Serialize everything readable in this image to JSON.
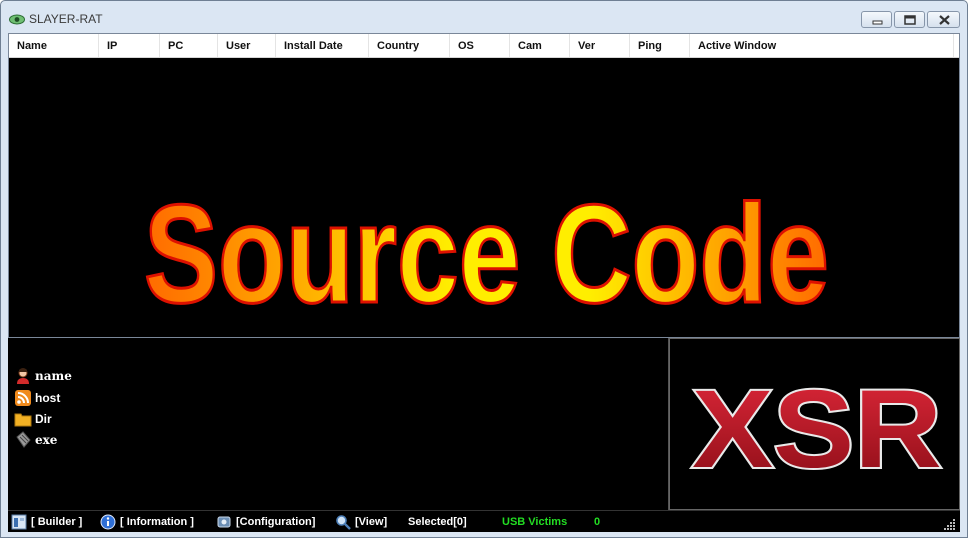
{
  "window": {
    "title": "SLAYER-RAT",
    "app_icon": "eye-icon",
    "controls": [
      "minimize-icon",
      "maximize-icon",
      "close-icon"
    ]
  },
  "table": {
    "columns": [
      "Name",
      "IP",
      "PC",
      "User",
      "Install Date",
      "Country",
      "OS",
      "Cam",
      "Ver",
      "Ping",
      "Active Window"
    ],
    "rows": []
  },
  "banner": {
    "text": "Source Code"
  },
  "details": {
    "items": [
      {
        "label": "name",
        "icon": "user-icon"
      },
      {
        "label": "host",
        "icon": "rss-icon"
      },
      {
        "label": "Dir",
        "icon": "folder-icon"
      },
      {
        "label": "exe",
        "icon": "file-icon"
      }
    ]
  },
  "logo": {
    "text": "XSR"
  },
  "statusbar": {
    "builder": "[ Builder ]",
    "information": "[ Information ]",
    "configuration": "[Configuration]",
    "view": "[View]",
    "selected": "Selected[0]",
    "usb_label": "USB Victims",
    "usb_count": "0"
  },
  "colors": {
    "accent_green": "#22dd22",
    "banner_yellow": "#ffee00",
    "banner_orange": "#ff6a00",
    "banner_outline": "#dd1100",
    "logo_red": "#b0121c"
  }
}
